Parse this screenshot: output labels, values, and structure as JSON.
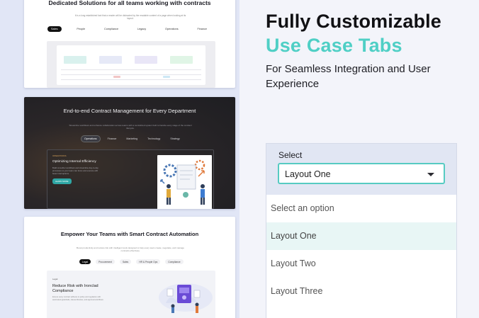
{
  "card1": {
    "heading": "Dedicated Solutions for all teams working with contracts",
    "subtext": "It is a long established fact that a reader will be distracted by the readable content of a page when looking at its layout.",
    "tabs": [
      "Sales",
      "People",
      "Compliance",
      "Legacy",
      "Operations",
      "Finance"
    ],
    "active_tab": 0
  },
  "card2": {
    "heading": "End-to-end Contract Management for Every Department",
    "subtext": "Streamline workflows and enhance collaboration across teams with a centralized system built to handle every stage of the contract lifecycle.",
    "tabs": [
      "Operations",
      "Finance",
      "Marketing",
      "Technology",
      "Strategy"
    ],
    "active_tab": 0,
    "panel_eyebrow": "OPERATIONS",
    "panel_title": "Optimizing Internal Efficiency",
    "panel_desc": "Build smoother workflows and streamline day-to-day processes so your team can focus and execute with fewer interruptions.",
    "panel_button": "LEARN MORE"
  },
  "card3": {
    "heading": "Empower Your Teams with Smart Contract Automation",
    "subtext": "Boost productivity and reduce risk with intelligent tools designed to help every team create, negotiate, and manage contracts effectively.",
    "tabs": [
      "Legal",
      "Procurement",
      "Sales",
      "HR & People Ops",
      "Compliance"
    ],
    "active_tab": 0,
    "panel_eyebrow": "Legal",
    "panel_title": "Reduce Risk with Ironclad Compliance",
    "panel_desc": "Ensure every contract adheres to policy and regulation with automated guardrails, clause libraries, and approval workflows."
  },
  "hero": {
    "title_line1": "Fully Customizable",
    "title_line2": "Use Case Tabs",
    "description": "For Seamless Integration and User Experience"
  },
  "select": {
    "label": "Select",
    "value": "Layout One",
    "options": [
      "Select an option",
      "Layout One",
      "Layout Two",
      "Layout Three"
    ],
    "highlighted_index": 1
  },
  "colors": {
    "accent": "#4fcfc5",
    "border_focus": "#56cbc2",
    "highlight": "#e8f6f5"
  }
}
